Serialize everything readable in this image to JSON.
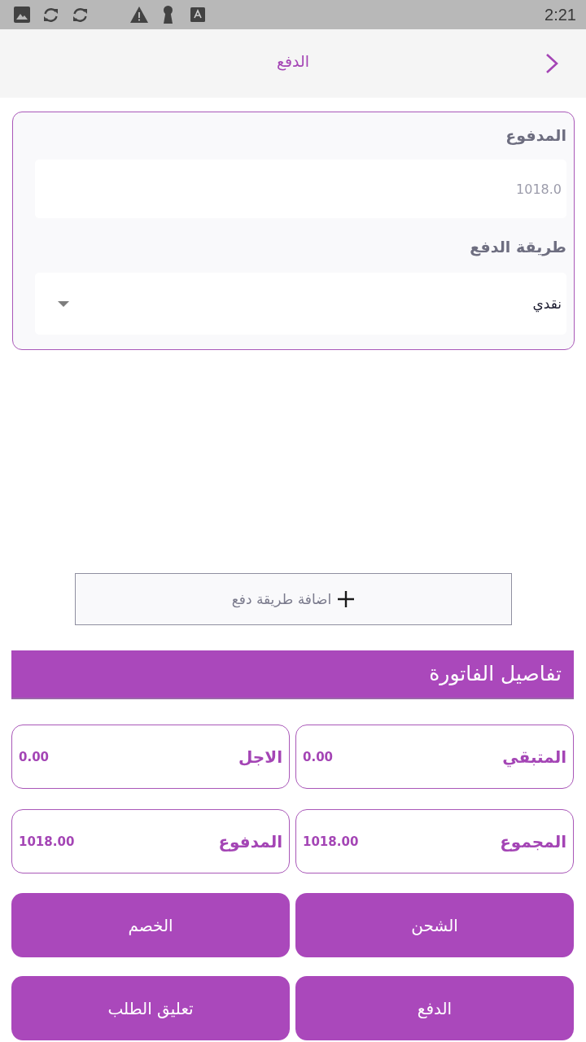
{
  "status_bar": {
    "time": "2:21"
  },
  "app_bar": {
    "title": "الدفع"
  },
  "payment_form": {
    "fields": [
      {
        "kind": "input",
        "label": "المدفوع",
        "placeholder": "1018.0"
      },
      {
        "kind": "dropdown",
        "label": "طريقة الدفع",
        "value": "نقدي"
      }
    ]
  },
  "add_payment_button": {
    "label": "اضافة طريقة دفع"
  },
  "invoice_details": {
    "title": "تفاصيل الفاتورة",
    "summary": [
      {
        "label": "المتبقي",
        "value": "0.00"
      },
      {
        "label": "الاجل",
        "value": "0.00"
      },
      {
        "label": "المجموع",
        "value": "1018.00"
      },
      {
        "label": "المدفوع",
        "value": "1018.00"
      }
    ],
    "actions": [
      {
        "label": "الشحن"
      },
      {
        "label": "الخصم"
      },
      {
        "label": "الدفع"
      },
      {
        "label": "تعليق الطلب"
      }
    ]
  }
}
